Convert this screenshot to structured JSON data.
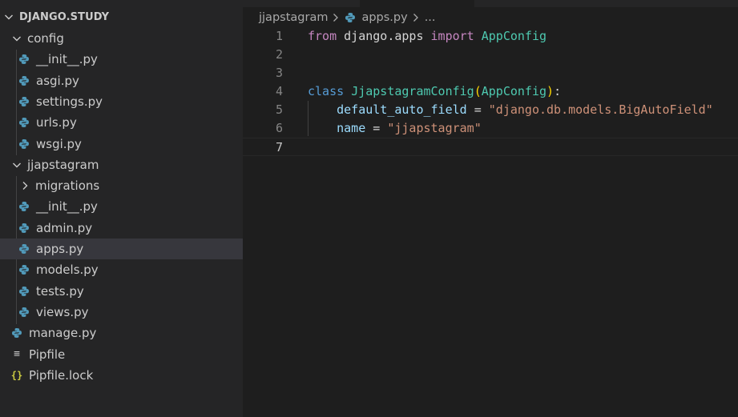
{
  "explorer": {
    "root_label": "DJANGO.STUDY",
    "items": [
      {
        "label": "config",
        "kind": "folder",
        "expanded": true
      },
      {
        "label": "__init__.py",
        "kind": "python"
      },
      {
        "label": "asgi.py",
        "kind": "python"
      },
      {
        "label": "settings.py",
        "kind": "python"
      },
      {
        "label": "urls.py",
        "kind": "python"
      },
      {
        "label": "wsgi.py",
        "kind": "python"
      },
      {
        "label": "jjapstagram",
        "kind": "folder",
        "expanded": true
      },
      {
        "label": "migrations",
        "kind": "folder",
        "expanded": false
      },
      {
        "label": "__init__.py",
        "kind": "python"
      },
      {
        "label": "admin.py",
        "kind": "python"
      },
      {
        "label": "apps.py",
        "kind": "python",
        "selected": true
      },
      {
        "label": "models.py",
        "kind": "python"
      },
      {
        "label": "tests.py",
        "kind": "python"
      },
      {
        "label": "views.py",
        "kind": "python"
      },
      {
        "label": "manage.py",
        "kind": "python"
      },
      {
        "label": "Pipfile",
        "kind": "text"
      },
      {
        "label": "Pipfile.lock",
        "kind": "json"
      }
    ]
  },
  "breadcrumb": {
    "folder": "jjapstagram",
    "file": "apps.py",
    "ellipsis": "..."
  },
  "editor": {
    "current_line": 7,
    "lines": [
      {
        "number": "1",
        "tokens": [
          {
            "t": "from",
            "c": "tok-kw"
          },
          {
            "t": " django.apps ",
            "c": "tok-op"
          },
          {
            "t": "import",
            "c": "tok-kw"
          },
          {
            "t": " ",
            "c": "tok-op"
          },
          {
            "t": "AppConfig",
            "c": "tok-cls"
          }
        ]
      },
      {
        "number": "2",
        "tokens": []
      },
      {
        "number": "3",
        "tokens": []
      },
      {
        "number": "4",
        "tokens": [
          {
            "t": "class",
            "c": "tok-decl"
          },
          {
            "t": " ",
            "c": "tok-op"
          },
          {
            "t": "JjapstagramConfig",
            "c": "tok-cls"
          },
          {
            "t": "(",
            "c": "tok-paren"
          },
          {
            "t": "AppConfig",
            "c": "tok-cls"
          },
          {
            "t": ")",
            "c": "tok-paren"
          },
          {
            "t": ":",
            "c": "tok-op"
          }
        ]
      },
      {
        "number": "5",
        "tokens": [
          {
            "t": "    ",
            "c": "tok-op"
          },
          {
            "t": "default_auto_field",
            "c": "tok-var"
          },
          {
            "t": " = ",
            "c": "tok-op"
          },
          {
            "t": "\"django.db.models.BigAutoField\"",
            "c": "tok-str"
          }
        ]
      },
      {
        "number": "6",
        "tokens": [
          {
            "t": "    ",
            "c": "tok-op"
          },
          {
            "t": "name",
            "c": "tok-var"
          },
          {
            "t": " = ",
            "c": "tok-op"
          },
          {
            "t": "\"jjapstagram\"",
            "c": "tok-str"
          }
        ]
      },
      {
        "number": "7",
        "tokens": []
      }
    ]
  },
  "colors": {
    "sidebar_bg": "#252526",
    "editor_bg": "#1e1e1e",
    "selection_bg": "#37373d",
    "python_icon_blue": "#3572a5",
    "python_icon_yellow": "#519aba",
    "json_icon": "#cbcb41"
  },
  "icons": {
    "folder_expanded": "chevron-down-icon",
    "folder_collapsed": "chevron-right-icon",
    "python": "python-file-icon",
    "text": "lines-file-icon",
    "json": "braces-file-icon"
  }
}
